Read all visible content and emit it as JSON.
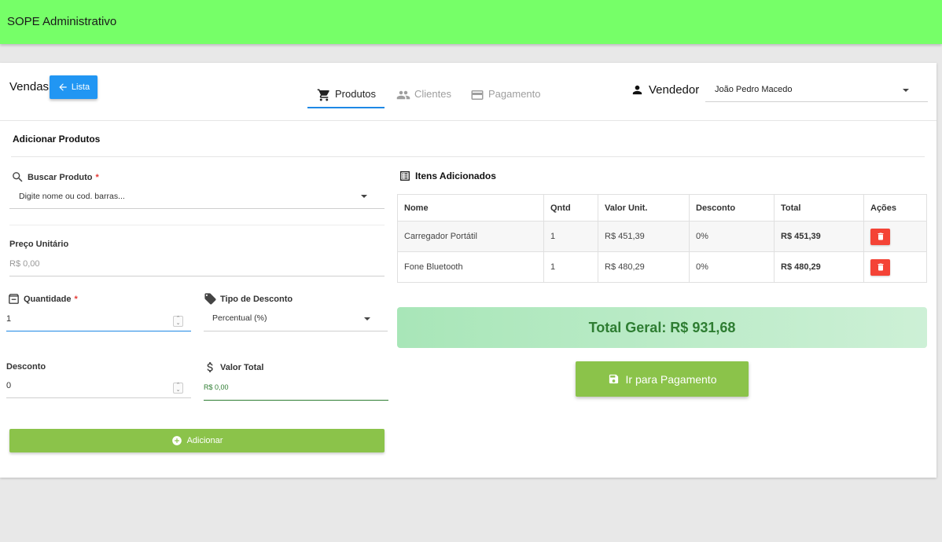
{
  "app": {
    "title": "SOPE Administrativo"
  },
  "header": {
    "title": "Vendas",
    "back_button": "Lista",
    "tabs": [
      {
        "label": "Produtos",
        "icon": "cart-icon",
        "active": true
      },
      {
        "label": "Clientes",
        "icon": "people-icon",
        "active": false
      },
      {
        "label": "Pagamento",
        "icon": "credit-card-icon",
        "active": false
      }
    ],
    "vendor_label": "Vendedor",
    "vendor_value": "João Pedro Macedo"
  },
  "form": {
    "section_title": "Adicionar Produtos",
    "search_label": "Buscar Produto",
    "required_mark": "*",
    "search_placeholder": "Digite nome ou cod. barras...",
    "unit_price_label": "Preço Unitário",
    "unit_price_placeholder": "R$ 0,00",
    "quantity_label": "Quantidade",
    "quantity_value": "1",
    "discount_type_label": "Tipo de Desconto",
    "discount_type_value": "Percentual (%)",
    "discount_label": "Desconto",
    "discount_value": "0",
    "total_value_label": "Valor Total",
    "total_value": "R$ 0,00",
    "add_button": "Adicionar"
  },
  "items": {
    "title": "Itens Adicionados",
    "columns": [
      "Nome",
      "Qntd",
      "Valor Unit.",
      "Desconto",
      "Total",
      "Ações"
    ],
    "rows": [
      {
        "nome": "Carregador Portátil",
        "qntd": "1",
        "valor": "R$ 451,39",
        "desconto": "0%",
        "total": "R$ 451,39"
      },
      {
        "nome": "Fone Bluetooth",
        "qntd": "1",
        "valor": "R$ 480,29",
        "desconto": "0%",
        "total": "R$ 480,29"
      }
    ]
  },
  "summary": {
    "total_label": "Total Geral: R$ 931,68",
    "pay_button": "Ir para Pagamento"
  },
  "colors": {
    "topbar": "#76ff68",
    "primary_blue": "#2196f3",
    "success_green": "#8bc34a",
    "danger_red": "#f44336",
    "total_text": "#2e7d32"
  }
}
